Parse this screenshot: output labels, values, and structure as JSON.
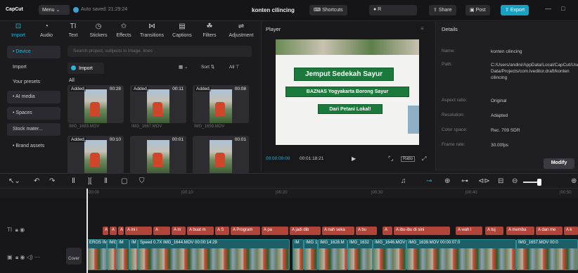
{
  "topbar": {
    "logo": "CapCut",
    "menu": "Menu",
    "autosave": "Auto saved: 21:29:24",
    "project_title": "konten cilincing",
    "shortcuts": "Shortcuts",
    "share": "Share",
    "post": "Post",
    "export": "Export"
  },
  "tools": [
    {
      "label": "Import",
      "icon": "import-icon"
    },
    {
      "label": "Audio",
      "icon": "audio-icon"
    },
    {
      "label": "Text",
      "icon": "text-icon"
    },
    {
      "label": "Stickers",
      "icon": "stickers-icon"
    },
    {
      "label": "Effects",
      "icon": "effects-icon"
    },
    {
      "label": "Transitions",
      "icon": "transitions-icon"
    },
    {
      "label": "Captions",
      "icon": "captions-icon"
    },
    {
      "label": "Filters",
      "icon": "filters-icon"
    },
    {
      "label": "Adjustment",
      "icon": "adjustment-icon"
    }
  ],
  "leftnav": [
    "• Device",
    "Import",
    "Your presets",
    "• AI media",
    "• Spaces",
    "Stock mater...",
    "• Brand assets"
  ],
  "media": {
    "search_placeholder": "Search project, subjects in image, lines",
    "import": "Import",
    "sort": "Sort",
    "all_filter": "All",
    "all_label": "All",
    "thumbs": [
      {
        "added": "Added",
        "dur": "00:28",
        "name": "IMG_1683.MOV"
      },
      {
        "added": "Added",
        "dur": "00:11",
        "name": "IMG_1667.MOV"
      },
      {
        "added": "Added",
        "dur": "00:08",
        "name": "IMG_1659.MOV"
      },
      {
        "added": "Added",
        "dur": "00:10",
        "name": ""
      },
      {
        "added": "",
        "dur": "00:01",
        "name": ""
      },
      {
        "added": "",
        "dur": "00:01",
        "name": ""
      }
    ]
  },
  "player": {
    "header": "Player",
    "banner1": "Jemput Sedekah Sayur",
    "banner2": "BAZNAS Yogyakarta Borong Sayur",
    "banner3": "Dari Petani Lokal!",
    "current_time": "00:00:00:00",
    "total_time": "00:01:18:21",
    "ratio": "Ratio"
  },
  "details": {
    "header": "Details",
    "rows": [
      {
        "k": "Name:",
        "v": "konten cilincing"
      },
      {
        "k": "Path:",
        "v": "C:/Users/andini/AppData/Local/CapCut/User Data/Projects/com.lveditor.draft/konten cilincing"
      },
      {
        "k": "Aspect ratio:",
        "v": "Original"
      },
      {
        "k": "Resolution:",
        "v": "Adapted"
      },
      {
        "k": "Color space:",
        "v": "Rec. 709 SDR"
      },
      {
        "k": "Frame rate:",
        "v": "30.00fps"
      }
    ],
    "modify": "Modify"
  },
  "ruler": [
    "00:00",
    "|00:10",
    "|00:20",
    "|00:30",
    "|00:40",
    "|00:50"
  ],
  "text_clips": [
    "A",
    "A",
    "A",
    "A ini i",
    "A",
    "A m",
    "A buat m",
    "A S",
    "A Program",
    "A pa",
    "A jadi dib",
    "A nah seka",
    "A bu",
    "A",
    "A ibu-ibu di sini",
    "A wah l",
    "A tuj",
    "A memba",
    "A dan me",
    "A k"
  ],
  "video_clips": [
    {
      "label": "EROS IM"
    },
    {
      "label": "IMG"
    },
    {
      "label": "IM"
    },
    {
      "label": "IM"
    },
    {
      "label": "Speed 0.7X  IMG_1644.MOV  00:00:14:29"
    },
    {
      "label": "IM"
    },
    {
      "label": "IMG 16"
    },
    {
      "label": "IMG_1628.M"
    },
    {
      "label": "IMG_1632"
    },
    {
      "label": "IMG_1646.MOV"
    },
    {
      "label": "IMG_1639.MOV  00:00:07:0"
    },
    {
      "label": "IMG_1657.MOV  00:0"
    }
  ],
  "timeline": {
    "cover": "Cover"
  },
  "colors": {
    "accent": "#27b5d8",
    "export": "#19a1c4",
    "text_clip": "#b04438",
    "video_clip": "#1e5e66"
  }
}
